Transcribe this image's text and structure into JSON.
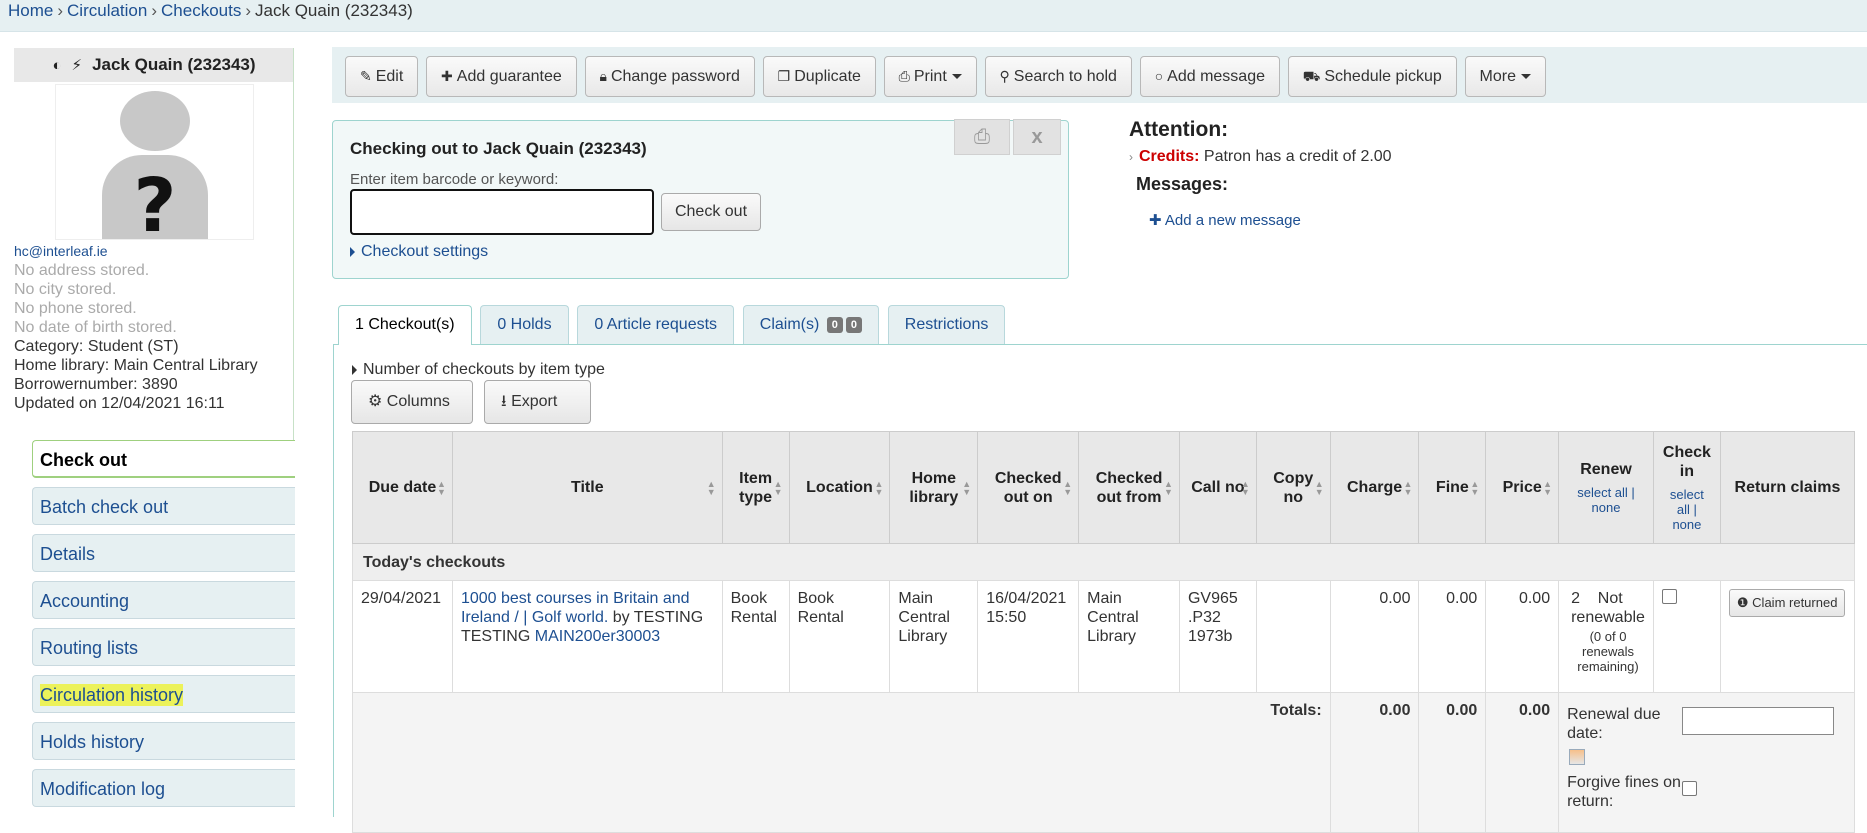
{
  "breadcrumb": {
    "home": "Home",
    "circulation": "Circulation",
    "checkouts": "Checkouts",
    "current": "Jack Quain (232343)",
    "sep": "›"
  },
  "patron": {
    "name": "Jack Quain (232343)",
    "email": "hc@interleaf.ie",
    "address": "No address stored.",
    "city": "No city stored.",
    "phone": "No phone stored.",
    "dob": "No date of birth stored.",
    "category": "Category: Student (ST)",
    "home_library": "Home library: Main Central Library",
    "borrowernumber": "Borrowernumber: 3890",
    "updated": "Updated on 12/04/2021 16:11"
  },
  "sidebar": {
    "items": [
      {
        "label": "Check out"
      },
      {
        "label": "Batch check out"
      },
      {
        "label": "Details"
      },
      {
        "label": "Accounting"
      },
      {
        "label": "Routing lists"
      },
      {
        "label": "Circulation history"
      },
      {
        "label": "Holds history"
      },
      {
        "label": "Modification log"
      }
    ]
  },
  "toolbar": {
    "edit": "Edit",
    "add_guarantee": "Add guarantee",
    "change_password": "Change password",
    "duplicate": "Duplicate",
    "print": "Print",
    "search_to_hold": "Search to hold",
    "add_message": "Add message",
    "schedule_pickup": "Schedule pickup",
    "more": "More"
  },
  "checkout": {
    "title": "Checking out to Jack Quain (232343)",
    "barcode_label": "Enter item barcode or keyword:",
    "barcode_value": "",
    "button": "Check out",
    "settings": "Checkout settings",
    "close": "x"
  },
  "attention": {
    "title": "Attention:",
    "credits_label": "Credits:",
    "credits_text": "Patron has a credit of 2.00",
    "messages_title": "Messages:",
    "add_message": "Add a new message"
  },
  "tabs": {
    "checkouts": "1 Checkout(s)",
    "holds": "0 Holds",
    "article_requests": "0 Article requests",
    "claims": "Claim(s)",
    "claims_badge1": "0",
    "claims_badge2": "0",
    "restrictions": "Restrictions"
  },
  "panel": {
    "num_checkouts": "Number of checkouts by item type",
    "columns": "Columns",
    "export": "Export"
  },
  "table": {
    "headers": {
      "due_date": "Due date",
      "title": "Title",
      "item_type": "Item type",
      "location": "Location",
      "home_library": "Home library",
      "checked_out_on": "Checked out on",
      "checked_out_from": "Checked out from",
      "call_no": "Call no",
      "copy_no": "Copy no",
      "charge": "Charge",
      "fine": "Fine",
      "price": "Price",
      "renew": "Renew",
      "renew_sub": "select all | none",
      "check_in": "Check in",
      "check_in_sub": "select all | none",
      "return_claims": "Return claims"
    },
    "group_label": "Today's checkouts",
    "row": {
      "due_date": "29/04/2021",
      "title_link": "1000 best courses in Britain and Ireland / | Golf world.",
      "by": "by TESTING TESTING",
      "barcode": "MAIN200er30003",
      "item_type": "Book Rental",
      "location": "Book Rental",
      "home_library": "Main Central Library",
      "checked_out_on": "16/04/2021 15:50",
      "checked_out_from": "Main Central Library",
      "call_no": "GV965 .P32 1973b",
      "copy_no": "",
      "charge": "0.00",
      "fine": "0.00",
      "price": "0.00",
      "renew_count": "2",
      "renew_status": "Not renewable",
      "renew_note": "(0 of 0 renewals remaining)",
      "claim_button": "Claim returned"
    },
    "totals": {
      "label": "Totals:",
      "charge": "0.00",
      "fine": "0.00",
      "price": "0.00",
      "renewal_due_date": "Renewal due date:",
      "forgive_fines": "Forgive fines on return:"
    }
  }
}
